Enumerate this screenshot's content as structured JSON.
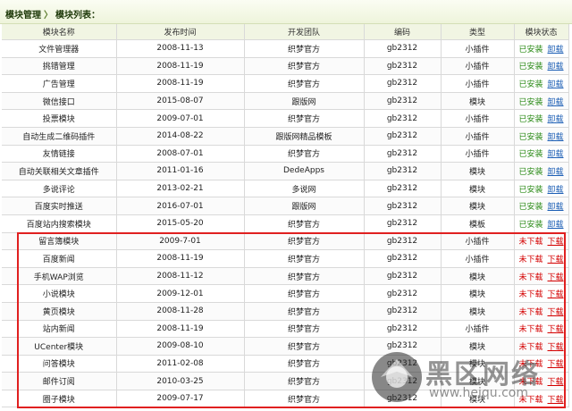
{
  "breadcrumb": {
    "root": "模块管理",
    "separator": "〉",
    "current": "模块列表："
  },
  "columns": [
    "模块名称",
    "发布时间",
    "开发团队",
    "编码",
    "类型",
    "模块状态"
  ],
  "rows": [
    {
      "name": "文件管理器",
      "date": "2008-11-13",
      "team": "织梦官方",
      "code": "gb2312",
      "type": "小插件",
      "status": "已安装",
      "action": "卸载",
      "installed": true
    },
    {
      "name": "挑错管理",
      "date": "2008-11-19",
      "team": "织梦官方",
      "code": "gb2312",
      "type": "小插件",
      "status": "已安装",
      "action": "卸载",
      "installed": true
    },
    {
      "name": "广告管理",
      "date": "2008-11-19",
      "team": "织梦官方",
      "code": "gb2312",
      "type": "小插件",
      "status": "已安装",
      "action": "卸载",
      "installed": true
    },
    {
      "name": "微信接口",
      "date": "2015-08-07",
      "team": "跟版网",
      "code": "gb2312",
      "type": "模块",
      "status": "已安装",
      "action": "卸载",
      "installed": true
    },
    {
      "name": "投票模块",
      "date": "2009-07-01",
      "team": "织梦官方",
      "code": "gb2312",
      "type": "小插件",
      "status": "已安装",
      "action": "卸载",
      "installed": true
    },
    {
      "name": "自动生成二维码插件",
      "date": "2014-08-22",
      "team": "跟版网精品模板",
      "code": "gb2312",
      "type": "小插件",
      "status": "已安装",
      "action": "卸载",
      "installed": true
    },
    {
      "name": "友情链接",
      "date": "2008-07-01",
      "team": "织梦官方",
      "code": "gb2312",
      "type": "小插件",
      "status": "已安装",
      "action": "卸载",
      "installed": true
    },
    {
      "name": "自动关联相关文章插件",
      "date": "2011-01-16",
      "team": "DedeApps",
      "code": "gb2312",
      "type": "模块",
      "status": "已安装",
      "action": "卸载",
      "installed": true
    },
    {
      "name": "多说评论",
      "date": "2013-02-21",
      "team": "多说网",
      "code": "gb2312",
      "type": "模块",
      "status": "已安装",
      "action": "卸载",
      "installed": true
    },
    {
      "name": "百度实时推送",
      "date": "2016-07-01",
      "team": "跟版网",
      "code": "gb2312",
      "type": "模块",
      "status": "已安装",
      "action": "卸载",
      "installed": true
    },
    {
      "name": "百度站内搜索模块",
      "date": "2015-05-20",
      "team": "织梦官方",
      "code": "gb2312",
      "type": "模板",
      "status": "已安装",
      "action": "卸载",
      "installed": true
    },
    {
      "name": "留言簿模块",
      "date": "2009-7-01",
      "team": "织梦官方",
      "code": "gb2312",
      "type": "小插件",
      "status": "未下载",
      "action": "下载",
      "installed": false
    },
    {
      "name": "百度新闻",
      "date": "2008-11-19",
      "team": "织梦官方",
      "code": "gb2312",
      "type": "小插件",
      "status": "未下载",
      "action": "下载",
      "installed": false
    },
    {
      "name": "手机WAP浏览",
      "date": "2008-11-12",
      "team": "织梦官方",
      "code": "gb2312",
      "type": "模块",
      "status": "未下载",
      "action": "下载",
      "installed": false
    },
    {
      "name": "小说模块",
      "date": "2009-12-01",
      "team": "织梦官方",
      "code": "gb2312",
      "type": "模块",
      "status": "未下载",
      "action": "下载",
      "installed": false
    },
    {
      "name": "黄页模块",
      "date": "2008-11-28",
      "team": "织梦官方",
      "code": "gb2312",
      "type": "模块",
      "status": "未下载",
      "action": "下载",
      "installed": false
    },
    {
      "name": "站内新闻",
      "date": "2008-11-19",
      "team": "织梦官方",
      "code": "gb2312",
      "type": "小插件",
      "status": "未下载",
      "action": "下载",
      "installed": false
    },
    {
      "name": "UCenter模块",
      "date": "2009-08-10",
      "team": "织梦官方",
      "code": "gb2312",
      "type": "模块",
      "status": "未下载",
      "action": "下载",
      "installed": false
    },
    {
      "name": "问答模块",
      "date": "2011-02-08",
      "team": "织梦官方",
      "code": "gb2312",
      "type": "模块",
      "status": "未下载",
      "action": "下载",
      "installed": false
    },
    {
      "name": "邮件订阅",
      "date": "2010-03-25",
      "team": "织梦官方",
      "code": "gb2312",
      "type": "模块",
      "status": "未下载",
      "action": "下载",
      "installed": false
    },
    {
      "name": "圈子模块",
      "date": "2009-07-17",
      "team": "织梦官方",
      "code": "gb2312",
      "type": "模块",
      "status": "未下载",
      "action": "下载",
      "installed": false
    }
  ],
  "watermark": {
    "text": "黑区网络",
    "url": "www.heiqu.com"
  },
  "colors": {
    "installed": "#2a8a16",
    "not_downloaded": "#d40000",
    "uninstall_link": "#1d5fb5",
    "highlight_border": "#e02020",
    "header_bg": "#f1f5e3"
  }
}
